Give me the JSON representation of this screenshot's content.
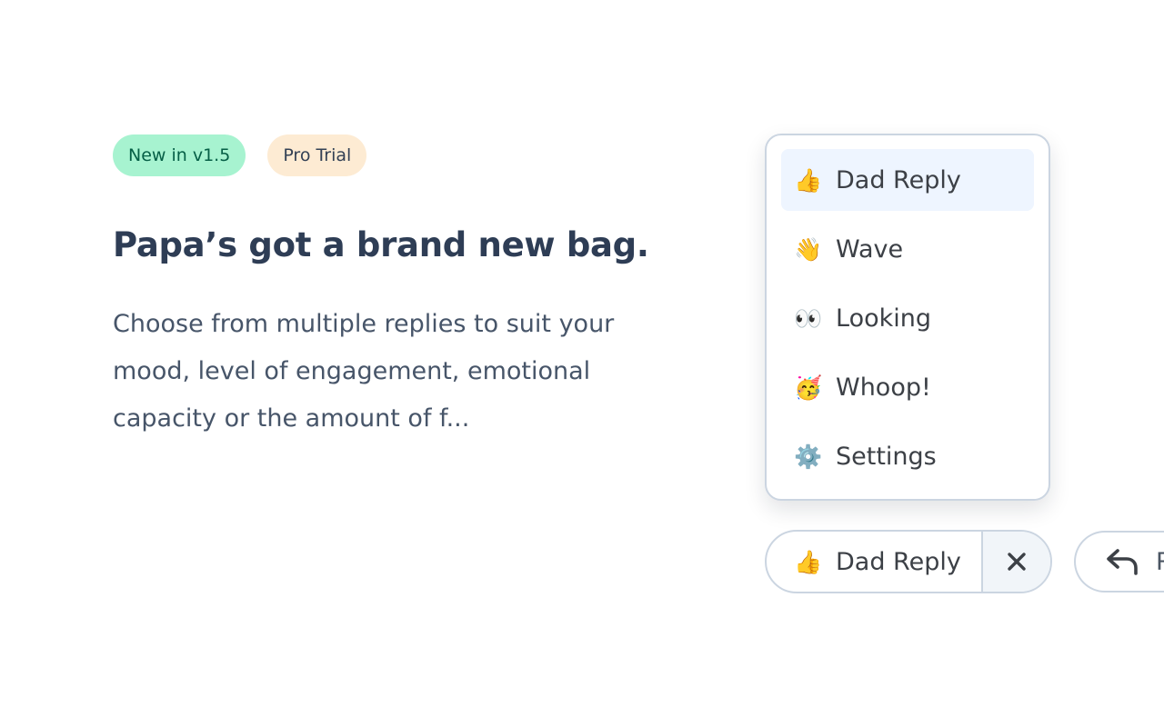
{
  "badges": {
    "new_label": "New in v1.5",
    "pro_label": "Pro Trial"
  },
  "headline": "Papa’s got a brand new bag.",
  "description": "Choose from multiple replies to suit your mood, level of engagement, emotional capacity or the amount of f...",
  "menu": {
    "items": [
      {
        "icon": "👍",
        "icon_name": "thumbs-up-icon",
        "label": "Dad Reply",
        "active": true
      },
      {
        "icon": "👋",
        "icon_name": "waving-hand-icon",
        "label": "Wave",
        "active": false
      },
      {
        "icon": "👀",
        "icon_name": "eyes-icon",
        "label": "Looking",
        "active": false
      },
      {
        "icon": "🥳",
        "icon_name": "party-face-icon",
        "label": "Whoop!",
        "active": false
      },
      {
        "icon": "⚙️",
        "icon_name": "gear-icon",
        "label": "Settings",
        "active": false
      }
    ]
  },
  "reply_button": {
    "icon": "👍",
    "label": "Dad Reply",
    "close_icon": "close-icon"
  },
  "secondary_button": {
    "icon": "reply-arrow-icon",
    "label_visible": "R"
  },
  "colors": {
    "badge_new_bg": "#a7f3d0",
    "badge_new_text": "#065f46",
    "badge_pro_bg": "#fdebd3",
    "headline": "#2e3d55",
    "body_text": "#475569",
    "border": "#cbd5e1",
    "active_item_bg": "#eef5ff"
  }
}
